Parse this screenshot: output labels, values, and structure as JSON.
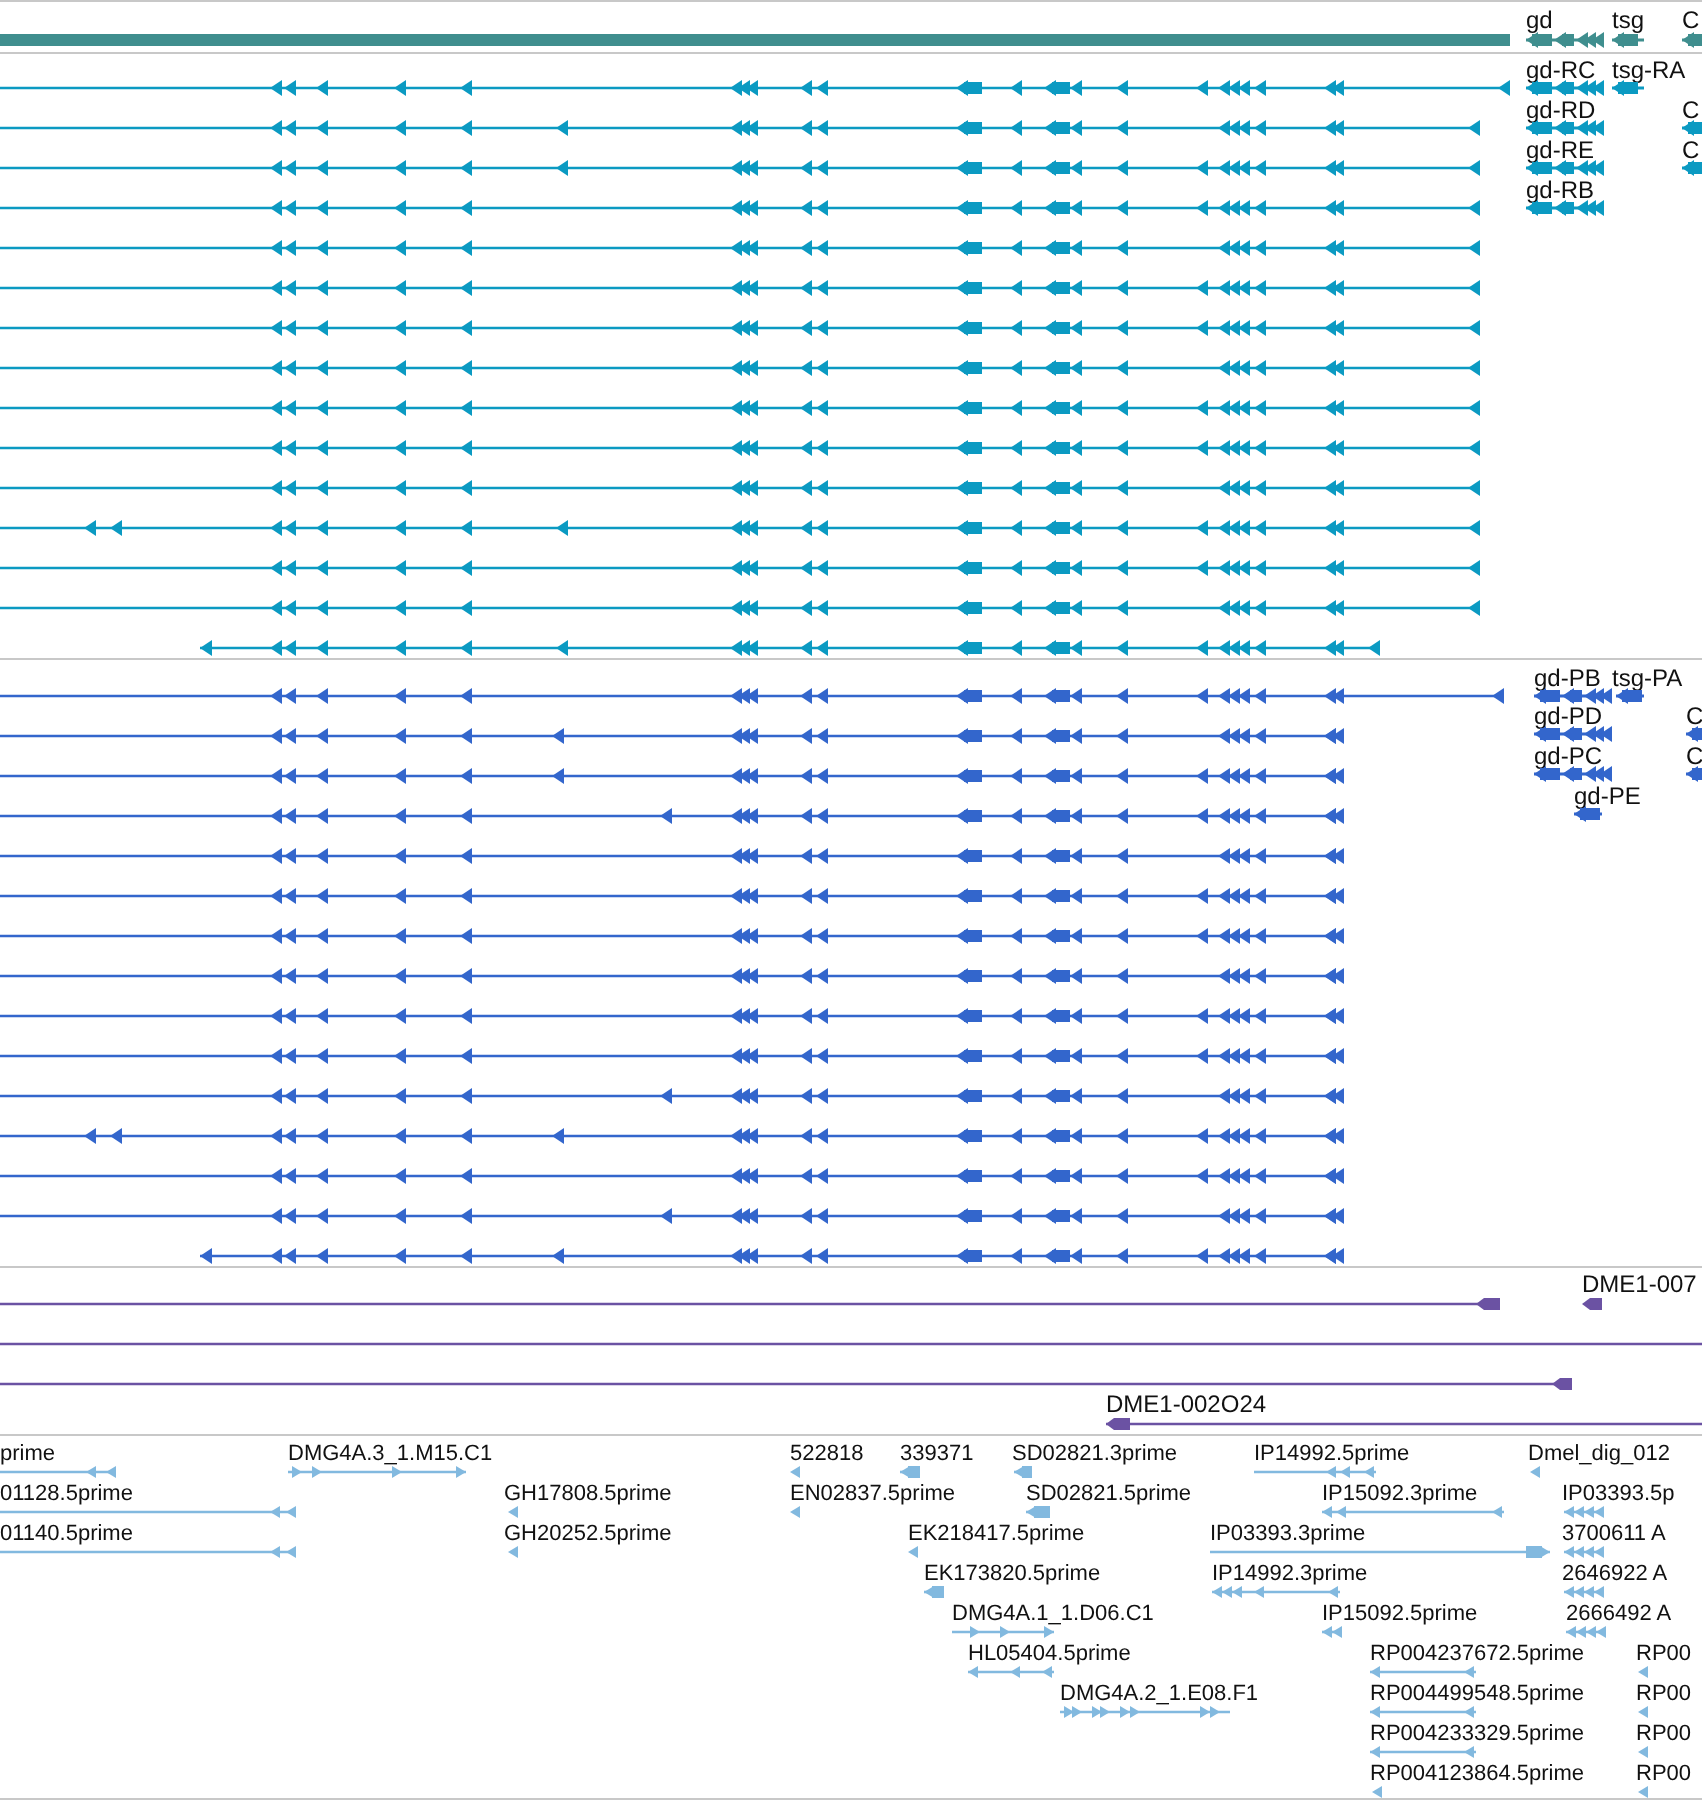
{
  "tracks": [
    {
      "kind": "overview",
      "color": "#3f8e8e",
      "features": [
        {
          "label": "gd"
        },
        {
          "label": "tsg"
        },
        {
          "label": "C"
        }
      ]
    },
    {
      "kind": "transcripts",
      "color": "#0b9ac2",
      "rows": [
        {
          "kind": "transcript"
        },
        {
          "kind": "transcript"
        },
        {
          "kind": "transcript"
        },
        {
          "kind": "transcript"
        },
        {
          "kind": "transcript"
        },
        {
          "kind": "transcript"
        },
        {
          "kind": "transcript"
        },
        {
          "kind": "transcript"
        },
        {
          "kind": "transcript"
        },
        {
          "kind": "transcript"
        },
        {
          "kind": "transcript"
        },
        {
          "kind": "transcript"
        },
        {
          "kind": "transcript"
        },
        {
          "kind": "transcript"
        },
        {
          "kind": "transcript"
        }
      ],
      "features": [
        {
          "label": "gd-RC"
        },
        {
          "label": "tsg-RA"
        },
        {
          "label": "gd-RD"
        },
        {
          "label": "C"
        },
        {
          "label": "gd-RE"
        },
        {
          "label": "C"
        },
        {
          "label": "gd-RB"
        }
      ]
    },
    {
      "kind": "transcripts",
      "color": "#3366cc",
      "rows": [
        {
          "kind": "transcript"
        },
        {
          "kind": "transcript"
        },
        {
          "kind": "transcript"
        },
        {
          "kind": "transcript"
        },
        {
          "kind": "transcript"
        },
        {
          "kind": "transcript"
        },
        {
          "kind": "transcript"
        },
        {
          "kind": "transcript"
        },
        {
          "kind": "transcript"
        },
        {
          "kind": "transcript"
        },
        {
          "kind": "transcript"
        },
        {
          "kind": "transcript"
        },
        {
          "kind": "transcript"
        },
        {
          "kind": "transcript"
        },
        {
          "kind": "transcript"
        }
      ],
      "features": [
        {
          "label": "gd-PB"
        },
        {
          "label": "tsg-PA"
        },
        {
          "label": "gd-PD"
        },
        {
          "label": "C"
        },
        {
          "label": "gd-PC"
        },
        {
          "label": "C"
        },
        {
          "label": "gd-PE"
        }
      ]
    },
    {
      "kind": "alignments",
      "color": "#6b52a3",
      "rows": [
        {
          "kind": "alignment"
        },
        {
          "kind": "alignment"
        },
        {
          "kind": "alignment"
        },
        {
          "kind": "alignment"
        }
      ],
      "features": [
        {
          "label": "DME1-007"
        },
        {
          "label": "DME1-002O24"
        }
      ]
    },
    {
      "kind": "ests",
      "color": "#82b9df",
      "features": [
        {
          "label": "prime"
        },
        {
          "label": "DMG4A.3_1.M15.C1"
        },
        {
          "label": "522818"
        },
        {
          "label": "339371"
        },
        {
          "label": "SD02821.3prime"
        },
        {
          "label": "IP14992.5prime"
        },
        {
          "label": "Dmel_dig_012"
        },
        {
          "label": "01128.5prime"
        },
        {
          "label": "GH17808.5prime"
        },
        {
          "label": "EN02837.5prime"
        },
        {
          "label": "SD02821.5prime"
        },
        {
          "label": "IP15092.3prime"
        },
        {
          "label": "IP03393.5p"
        },
        {
          "label": "01140.5prime"
        },
        {
          "label": "GH20252.5prime"
        },
        {
          "label": "EK218417.5prime"
        },
        {
          "label": "IP03393.3prime"
        },
        {
          "label": "3700611 A"
        },
        {
          "label": "EK173820.5prime"
        },
        {
          "label": "IP14992.3prime"
        },
        {
          "label": "2646922 A"
        },
        {
          "label": "DMG4A.1_1.D06.C1"
        },
        {
          "label": "IP15092.5prime"
        },
        {
          "label": "2666492 A"
        },
        {
          "label": "HL05404.5prime"
        },
        {
          "label": "RP004237672.5prime"
        },
        {
          "label": "RP00"
        },
        {
          "label": "DMG4A.2_1.E08.F1"
        },
        {
          "label": "RP004499548.5prime"
        },
        {
          "label": "RP00"
        },
        {
          "label": "RP004233329.5prime"
        },
        {
          "label": "RP00"
        },
        {
          "label": "RP004123864.5prime"
        },
        {
          "label": "RP00"
        }
      ]
    }
  ]
}
